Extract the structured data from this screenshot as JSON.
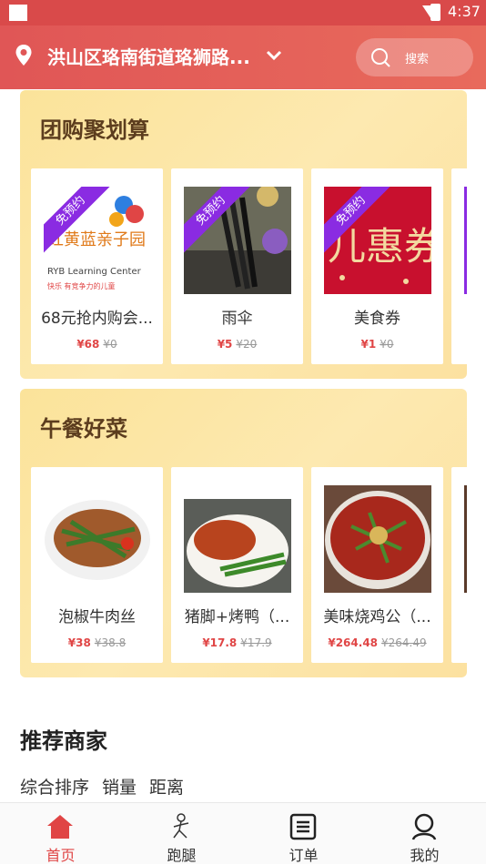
{
  "status_bar": {
    "time": "4:37"
  },
  "header": {
    "address": "洪山区珞南街道珞狮路...",
    "search_label": "搜索"
  },
  "colors": {
    "brand": "#e05656",
    "price": "#e04545",
    "ribbon": "#8a2be2"
  },
  "group_buy": {
    "title": "团购聚划算",
    "items": [
      {
        "name": "68元抢内购会...",
        "price": "¥68",
        "old_price": "¥0",
        "badge": "免预约"
      },
      {
        "name": "雨伞",
        "price": "¥5",
        "old_price": "¥20",
        "badge": "免预约"
      },
      {
        "name": "美食券",
        "price": "¥1",
        "old_price": "¥0",
        "badge": "免预约"
      }
    ]
  },
  "lunch": {
    "title": "午餐好菜",
    "items": [
      {
        "name": "泡椒牛肉丝",
        "price": "¥38",
        "old_price": "¥38.8"
      },
      {
        "name": "猪脚+烤鸭（...",
        "price": "¥17.8",
        "old_price": "¥17.9"
      },
      {
        "name": "美味烧鸡公（...",
        "price": "¥264.48",
        "old_price": "¥264.49"
      }
    ]
  },
  "recommend": {
    "title": "推荐商家",
    "sorts": [
      "综合排序",
      "销量",
      "距离"
    ]
  },
  "tabbar": {
    "tabs": [
      {
        "label": "首页",
        "icon": "home-icon"
      },
      {
        "label": "跑腿",
        "icon": "runner-icon"
      },
      {
        "label": "订单",
        "icon": "order-icon"
      },
      {
        "label": "我的",
        "icon": "profile-icon"
      }
    ]
  }
}
